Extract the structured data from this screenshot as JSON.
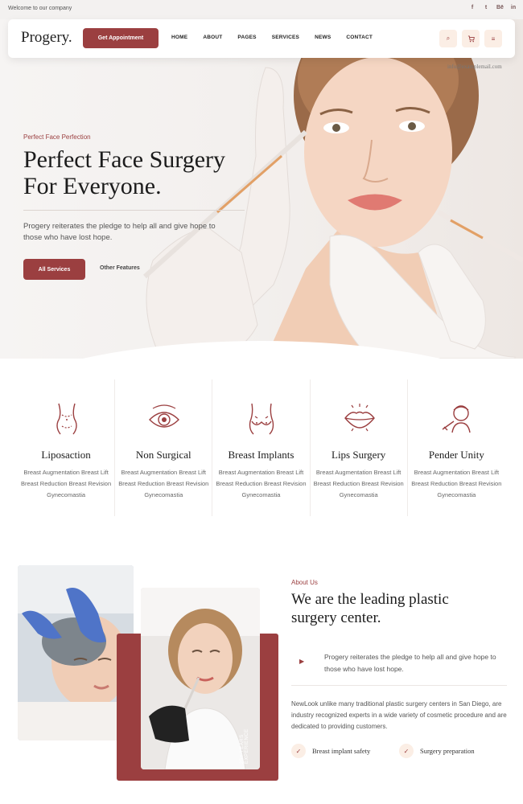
{
  "topbar": {
    "welcome": "Welcome to our company",
    "socials": [
      {
        "icon": "facebook-icon",
        "glyph": "f"
      },
      {
        "icon": "twitter-icon",
        "glyph": "t"
      },
      {
        "icon": "behance-icon",
        "glyph": "Bē"
      },
      {
        "icon": "linkedin-icon",
        "glyph": "in"
      }
    ]
  },
  "navbar": {
    "logo": "Progery.",
    "appointment_label": "Get Appointment",
    "menu": [
      "HOME",
      "ABOUT",
      "PAGES",
      "SERVICES",
      "NEWS",
      "CONTACT"
    ],
    "icons": [
      {
        "name": "search-icon",
        "glyph": "⌕"
      },
      {
        "name": "cart-icon",
        "glyph": "🛒"
      },
      {
        "name": "menu-icon",
        "glyph": "≡"
      }
    ],
    "email": "info@examplemail.com"
  },
  "hero": {
    "eyebrow": "Perfect Face Perfection",
    "title": "Perfect Face Surgery For Everyone.",
    "description": "Progery reiterates the pledge to help all and give hope to those who have lost hope.",
    "primary_button": "All Services",
    "secondary_button": "Other Features"
  },
  "services": [
    {
      "icon": "liposuction-icon",
      "title": "Liposaction",
      "desc": "Breast Augmentation Breast Lift Breast Reduction Breast Revision Gynecomastia"
    },
    {
      "icon": "eye-icon",
      "title": "Non Surgical",
      "desc": "Breast Augmentation Breast Lift Breast Reduction Breast Revision Gynecomastia"
    },
    {
      "icon": "breast-implant-icon",
      "title": "Breast Implants",
      "desc": "Breast Augmentation Breast Lift Breast Reduction Breast Revision Gynecomastia"
    },
    {
      "icon": "lips-icon",
      "title": "Lips Surgery",
      "desc": "Breast Augmentation Breast Lift Breast Reduction Breast Revision Gynecomastia"
    },
    {
      "icon": "injection-face-icon",
      "title": "Pender Unity",
      "desc": "Breast Augmentation Breast Lift Breast Reduction Breast Revision Gynecomastia"
    }
  ],
  "about": {
    "eyebrow": "About Us",
    "title": "We are the leading plastic surgery center.",
    "quote": "Progery reiterates the pledge to help all and give hope to those who have lost hope.",
    "body": "NewLook unlike many traditional plastic surgery centers in San Diego, are industry recognized experts in a wide variety of cosmetic procedure and are dedicated to providing customers.",
    "experience": "25+ YEARS EXPERIENCE",
    "features": [
      "Breast implant safety",
      "Surgery preparation"
    ]
  },
  "colors": {
    "accent": "#9b3f40",
    "accent_light": "#fbeee5"
  }
}
